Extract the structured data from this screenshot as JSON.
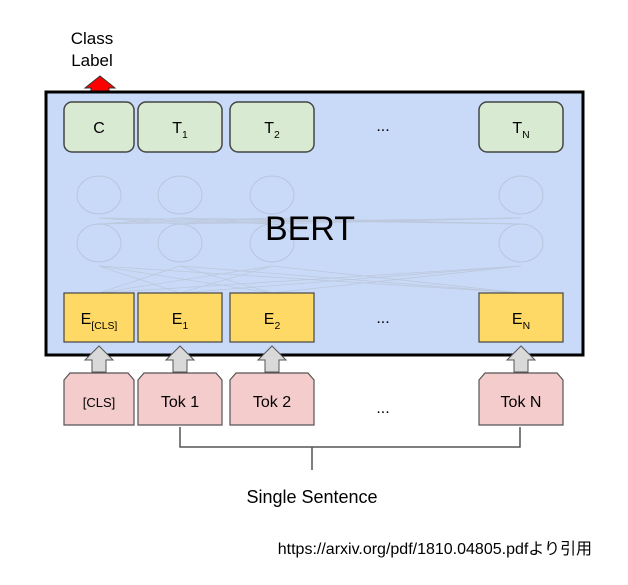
{
  "output_label": "Class\nLabel",
  "model_label": "BERT",
  "outputs": [
    {
      "main": "C",
      "sub": ""
    },
    {
      "main": "T",
      "sub": "1"
    },
    {
      "main": "T",
      "sub": "2"
    },
    {
      "main": "T",
      "sub": "N"
    }
  ],
  "embeddings": [
    {
      "main": "E",
      "sub": "[CLS]"
    },
    {
      "main": "E",
      "sub": "1"
    },
    {
      "main": "E",
      "sub": "2"
    },
    {
      "main": "E",
      "sub": "N"
    }
  ],
  "tokens": [
    "[CLS]",
    "Tok 1",
    "Tok 2",
    "Tok N"
  ],
  "ellipsis": "...",
  "input_label": "Single Sentence",
  "source_note": "https://arxiv.org/pdf/1810.04805.pdfより引用",
  "colors": {
    "model_bg": "#c9daf8",
    "output_box": "#d9ead3",
    "embedding_box": "#ffd966",
    "token_box": "#f4cccc",
    "arrow_red": "#ff0000",
    "arrow_gray": "#d9d9d9"
  }
}
